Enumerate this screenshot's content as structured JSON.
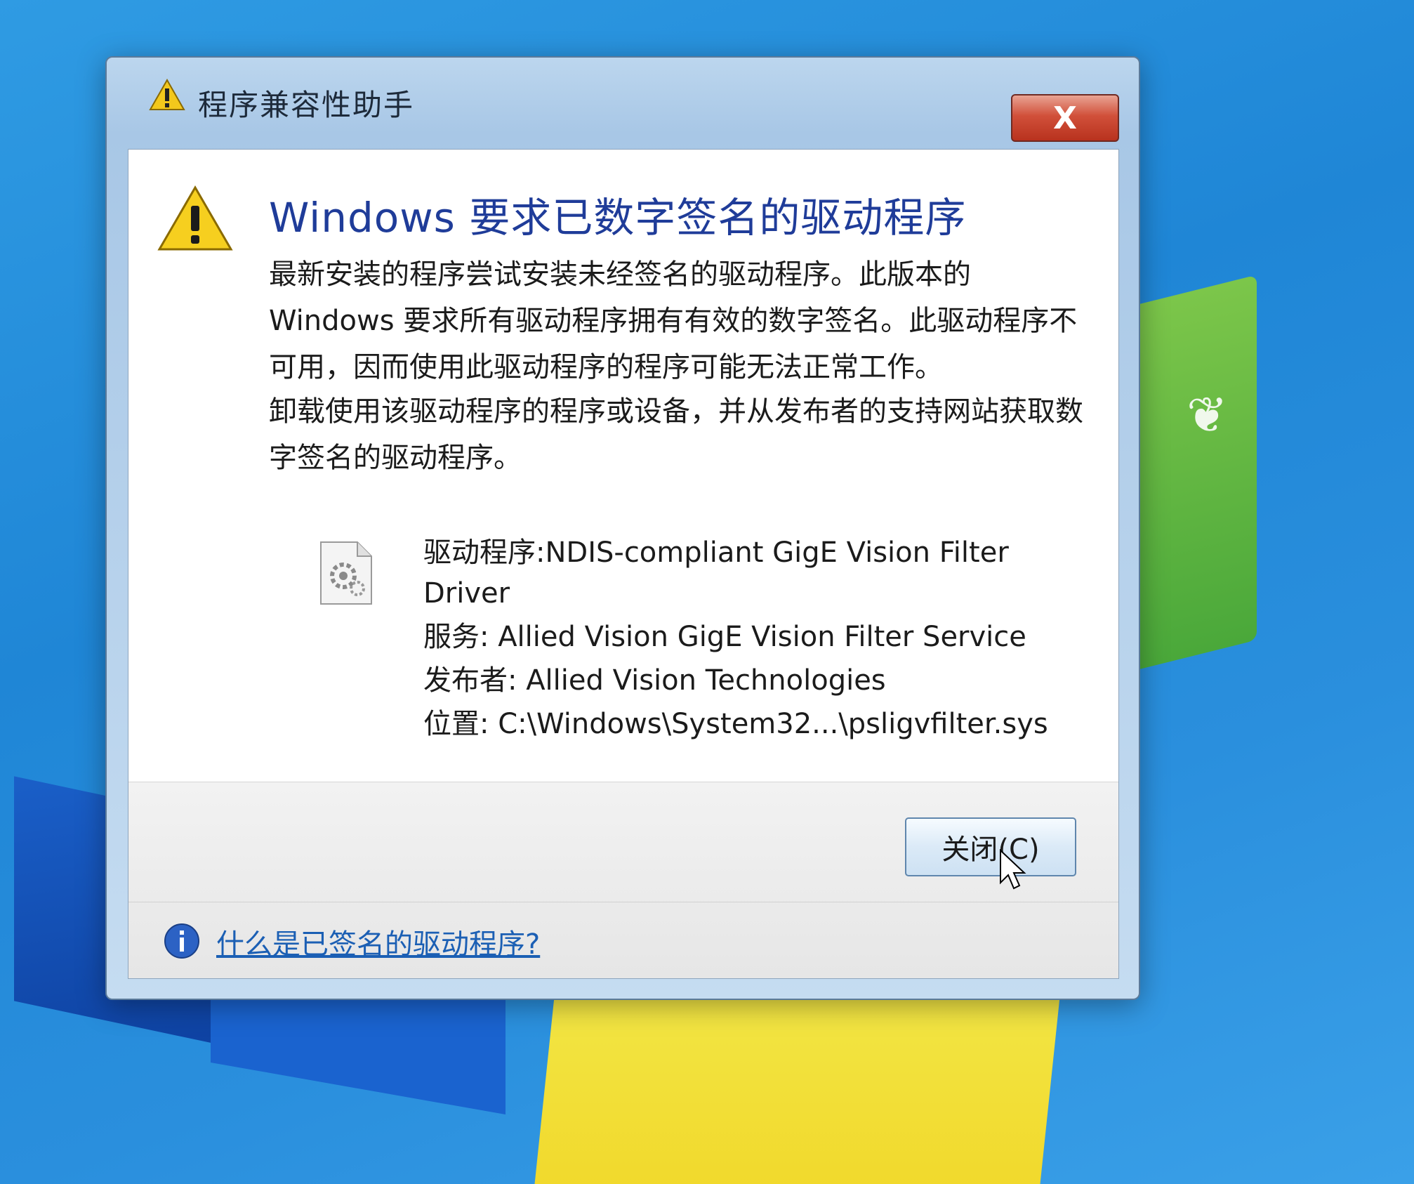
{
  "window": {
    "title": "程序兼容性助手",
    "close_glyph": "X"
  },
  "dialog": {
    "headline": "Windows 要求已数字签名的驱动程序",
    "paragraph1": "最新安装的程序尝试安装未经签名的驱动程序。此版本的 Windows 要求所有驱动程序拥有有效的数字签名。此驱动程序不可用，因而使用此驱动程序的程序可能无法正常工作。",
    "paragraph2": "卸载使用该驱动程序的程序或设备，并从发布者的支持网站获取数字签名的驱动程序。",
    "details": {
      "driver": "驱动程序:NDIS-compliant GigE Vision Filter Driver",
      "service": "服务: Allied Vision GigE Vision Filter Service",
      "publisher": "发布者: Allied Vision Technologies",
      "location": "位置: C:\\Windows\\System32...\\psligvfilter.sys"
    },
    "close_button_label": "关闭(C)",
    "help_link": "什么是已签名的驱动程序?"
  },
  "colors": {
    "headline": "#1f3c99",
    "link": "#1b5fb4",
    "close_red": "#c23a26"
  },
  "icons": [
    "warning-icon",
    "driver-file-icon",
    "info-icon",
    "mouse-cursor-icon"
  ]
}
